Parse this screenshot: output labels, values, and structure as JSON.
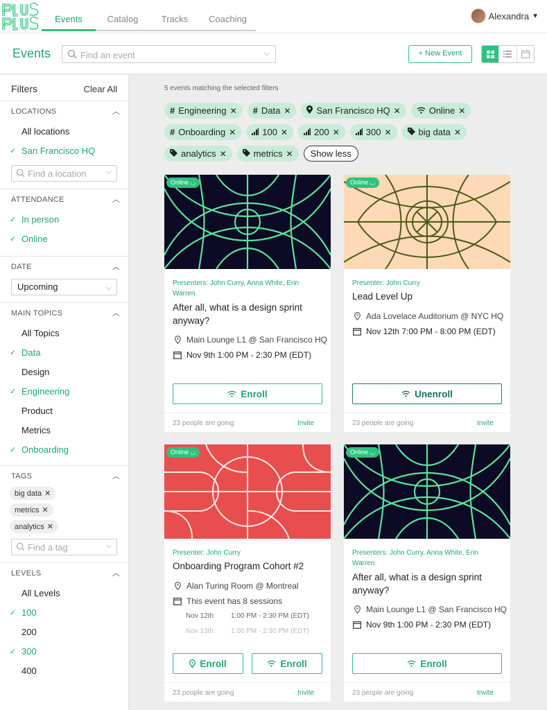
{
  "brand": {
    "logo_text": "Plus Plus",
    "accent": "#2ec27e"
  },
  "nav": {
    "tabs": [
      "Events",
      "Catalog",
      "Tracks",
      "Coaching"
    ],
    "active": "Events"
  },
  "user": {
    "name": "Alexandra"
  },
  "header": {
    "title": "Events",
    "search_placeholder": "Find an event",
    "new_event_label": "+ New Event",
    "views": [
      "grid-view-icon",
      "list-view-icon",
      "calendar-view-icon"
    ]
  },
  "sidebar": {
    "title": "Filters",
    "clear_all": "Clear All",
    "locations": {
      "title": "LOCATIONS",
      "options": [
        "All locations",
        "San Francisco HQ"
      ],
      "find_placeholder": "Find a location"
    },
    "attendance": {
      "title": "ATTENDANCE",
      "options": [
        "In person",
        "Online"
      ]
    },
    "date": {
      "title": "DATE",
      "value": "Upcoming"
    },
    "main_topics": {
      "title": "MAIN TOPICS",
      "options": [
        "All Topics",
        "Data",
        "Design",
        "Engineering",
        "Product",
        "Metrics",
        "Onboarding"
      ]
    },
    "tags": {
      "title": "TAGS",
      "items": [
        "big data",
        "metrics",
        "analytics"
      ],
      "find_placeholder": "Find a tag"
    },
    "levels": {
      "title": "LEVELS",
      "options": [
        "All Levels",
        "100",
        "200",
        "300",
        "400"
      ]
    }
  },
  "results": {
    "count_text": "5 events matching the selected filters",
    "chips": [
      {
        "icon": "#",
        "label": "Engineering"
      },
      {
        "icon": "#",
        "label": "Data"
      },
      {
        "icon": "pin",
        "label": "San Francisco HQ"
      },
      {
        "icon": "wifi",
        "label": "Online"
      },
      {
        "icon": "#",
        "label": "Onboarding"
      },
      {
        "icon": "bars",
        "label": "100"
      },
      {
        "icon": "bars",
        "label": "200"
      },
      {
        "icon": "bars",
        "label": "300"
      },
      {
        "icon": "tag",
        "label": "big data"
      },
      {
        "icon": "tag",
        "label": "analytics"
      },
      {
        "icon": "tag",
        "label": "metrics"
      }
    ],
    "show_less": "Show less"
  },
  "cards": [
    {
      "badge": "Online",
      "presenters": "Presenters: John Curry, Anna White, Erin Warren",
      "title": "After all, what is a design sprint anyway?",
      "location": "Main Lounge L1 @ San Francisco HQ",
      "date": "Nov 9th 1:00 PM - 2:30 PM (EDT)",
      "button": "Enroll",
      "going": "23 people are going",
      "invite": "Invite"
    },
    {
      "badge": "Online",
      "presenters": "Presenter: John Curry",
      "title": "Lead Level Up",
      "location": "Ada Lovelace Auditorium @ NYC HQ",
      "date": "Nov 12th 7:00 PM - 8:00 PM (EDT)",
      "button": "Unenroll",
      "going": "23 people are going",
      "invite": "Invite"
    },
    {
      "badge": "Online",
      "presenters": "Presenter: John Curry",
      "title": "Onboarding Program Cohort #2",
      "location": "Alan Turing Room @ Montreal",
      "date": "This event has 8 sessions",
      "sessions": [
        {
          "day": "Nov 12th",
          "time": "1:00 PM - 2:30 PM (EDT)"
        },
        {
          "day": "Nov 13th",
          "time": "1:00 PM - 2:30 PM (EDT)"
        }
      ],
      "button": "Enroll",
      "button2": "Enroll",
      "going": "23 people are going",
      "invite": "Invite"
    },
    {
      "badge": "Online",
      "presenters": "Presenters: John Curry, Anna White, Erin Warren",
      "title": "After all, what is a design sprint anyway?",
      "location": "Main Lounge L1 @ San Francisco HQ",
      "date": "Nov 9th 1:00 PM - 2:30 PM (EDT)",
      "button": "Enroll",
      "going": "23 people are going",
      "invite": "Invite"
    }
  ]
}
